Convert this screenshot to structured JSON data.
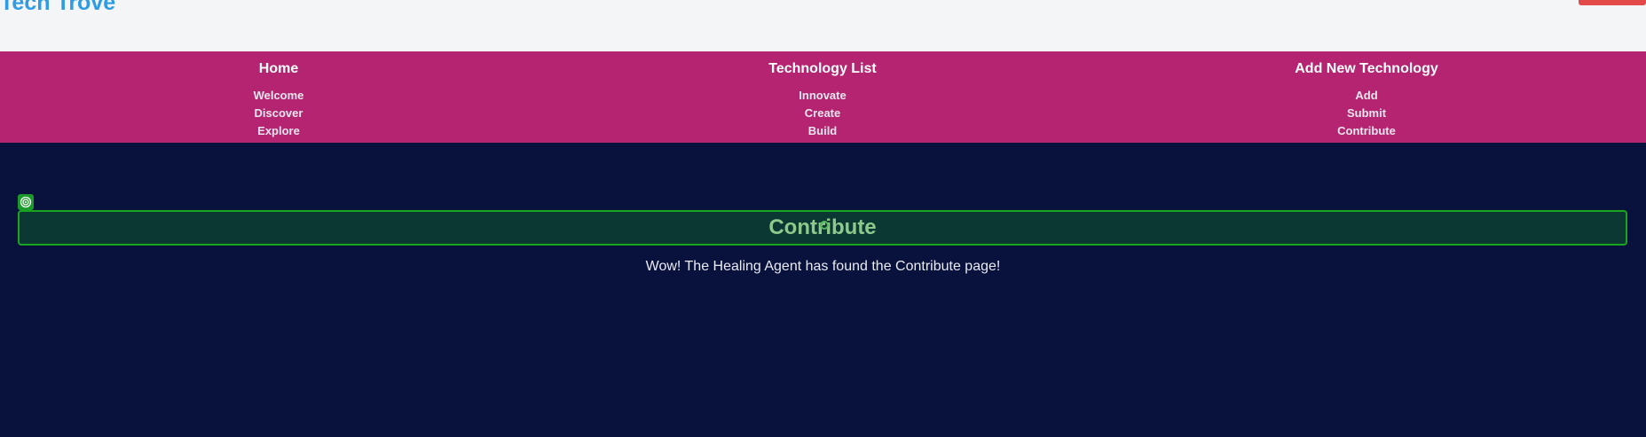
{
  "header": {
    "brand": "Tech Trove"
  },
  "nav": {
    "columns": [
      {
        "title": "Home",
        "links": [
          "Welcome",
          "Discover",
          "Explore"
        ]
      },
      {
        "title": "Technology List",
        "links": [
          "Innovate",
          "Create",
          "Build"
        ]
      },
      {
        "title": "Add New Technology",
        "links": [
          "Add",
          "Submit",
          "Contribute"
        ]
      }
    ]
  },
  "main": {
    "heading": "Contribute",
    "message": "Wow! The Healing Agent has found the Contribute page!"
  },
  "colors": {
    "nav_bg": "#b52471",
    "page_bg": "#09123d",
    "heading_box_bg": "#0b3832",
    "heading_border": "#1aa51f",
    "brand": "#2e9be3"
  },
  "icons": {
    "heal_badge": "target-icon"
  }
}
